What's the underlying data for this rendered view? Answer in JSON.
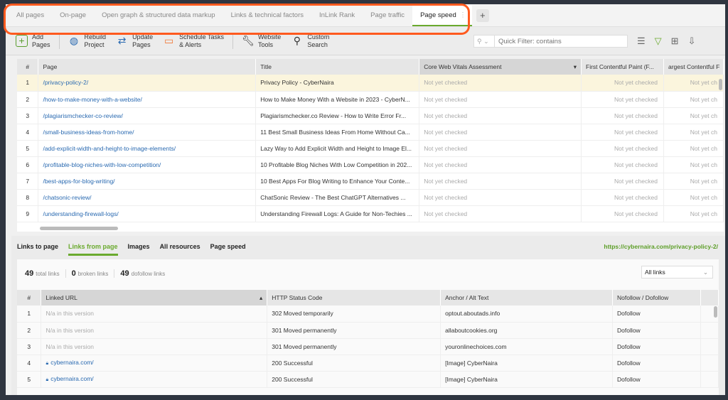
{
  "tabs": [
    "All pages",
    "On-page",
    "Open graph & structured data markup",
    "Links & technical factors",
    "InLink Rank",
    "Page traffic",
    "Page speed"
  ],
  "active_tab": "Page speed",
  "toolbar": {
    "add": [
      "Add",
      "Pages"
    ],
    "rebuild": [
      "Rebuild",
      "Project"
    ],
    "update": [
      "Update",
      "Pages"
    ],
    "schedule": [
      "Schedule Tasks",
      "& Alerts"
    ],
    "tools": [
      "Website",
      "Tools"
    ],
    "search": [
      "Custom",
      "Search"
    ]
  },
  "filter": {
    "placeholder": "Quick Filter: contains"
  },
  "grid": {
    "headers": [
      "#",
      "Page",
      "Title",
      "Core Web Vitals Assessment",
      "First Contentful Paint (F...",
      "argest Contentful F"
    ],
    "status": "Not yet checked",
    "status_short": "Not yet ch",
    "rows": [
      {
        "n": "1",
        "page": "/privacy-policy-2/",
        "title": "Privacy Policy - CyberNaira"
      },
      {
        "n": "2",
        "page": "/how-to-make-money-with-a-website/",
        "title": "How to Make Money With a Website in 2023 - CyberN..."
      },
      {
        "n": "3",
        "page": "/plagiarismchecker-co-review/",
        "title": "Plagiarismchecker.co Review - How to Write Error Fr..."
      },
      {
        "n": "4",
        "page": "/small-business-ideas-from-home/",
        "title": "11 Best Small Business Ideas From Home Without Ca..."
      },
      {
        "n": "5",
        "page": "/add-explicit-width-and-height-to-image-elements/",
        "title": "Lazy Way to Add Explicit Width and Height to Image El..."
      },
      {
        "n": "6",
        "page": "/profitable-blog-niches-with-low-competition/",
        "title": "10 Profitable Blog Niches With Low Competition in 202..."
      },
      {
        "n": "7",
        "page": "/best-apps-for-blog-writing/",
        "title": "10 Best Apps For Blog Writing to Enhance Your Conte..."
      },
      {
        "n": "8",
        "page": "/chatsonic-review/",
        "title": "ChatSonic Review - The Best ChatGPT Alternatives ..."
      },
      {
        "n": "9",
        "page": "/understanding-firewall-logs/",
        "title": "Understanding Firewall Logs: A Guide for Non-Techies ..."
      }
    ]
  },
  "bottom": {
    "tabs": [
      "Links to page",
      "Links from page",
      "Images",
      "All resources",
      "Page speed"
    ],
    "active": "Links from page",
    "url": "https://cybernaira.com/privacy-policy-2/",
    "stats": [
      {
        "n": "49",
        "l": "total links"
      },
      {
        "n": "0",
        "l": "broken links"
      },
      {
        "n": "49",
        "l": "dofollow links"
      }
    ],
    "dropdown": "All links",
    "headers": [
      "#",
      "Linked URL",
      "HTTP Status Code",
      "Anchor / Alt Text",
      "Nofollow / Dofollow"
    ],
    "rows": [
      {
        "n": "1",
        "url": "N/a in this version",
        "code": "302 Moved temporarily",
        "anchor": "optout.aboutads.info",
        "follow": "Dofollow"
      },
      {
        "n": "2",
        "url": "N/a in this version",
        "code": "301 Moved permanently",
        "anchor": "allaboutcookies.org",
        "follow": "Dofollow"
      },
      {
        "n": "3",
        "url": "N/a in this version",
        "code": "301 Moved permanently",
        "anchor": "youronlinechoices.com",
        "follow": "Dofollow"
      },
      {
        "n": "4",
        "url": "cybernaira.com/",
        "code": "200 Successful",
        "anchor": "[Image] CyberNaira",
        "follow": "Dofollow"
      },
      {
        "n": "5",
        "url": "cybernaira.com/",
        "code": "200 Successful",
        "anchor": "[Image] CyberNaira",
        "follow": "Dofollow"
      }
    ]
  }
}
